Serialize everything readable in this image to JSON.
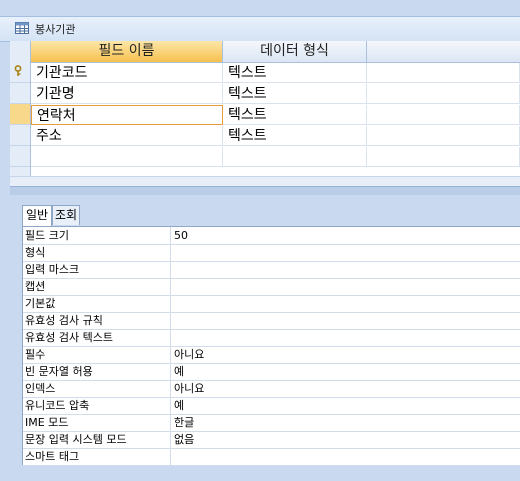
{
  "window": {
    "title": "봉사기관"
  },
  "grid": {
    "headers": [
      "필드 이름",
      "데이터 형식",
      ""
    ],
    "rows": [
      {
        "name": "기관코드",
        "type": "텍스트",
        "key": true
      },
      {
        "name": "기관명",
        "type": "텍스트",
        "key": false
      },
      {
        "name": "연락처",
        "type": "텍스트",
        "key": false,
        "current": true
      },
      {
        "name": "주소",
        "type": "텍스트",
        "key": false
      }
    ]
  },
  "property_tabs": [
    "일반",
    "조회"
  ],
  "properties": [
    {
      "name": "필드 크기",
      "value": "50"
    },
    {
      "name": "형식",
      "value": ""
    },
    {
      "name": "입력 마스크",
      "value": ""
    },
    {
      "name": "캡션",
      "value": ""
    },
    {
      "name": "기본값",
      "value": ""
    },
    {
      "name": "유효성 검사 규칙",
      "value": ""
    },
    {
      "name": "유효성 검사 텍스트",
      "value": ""
    },
    {
      "name": "필수",
      "value": "아니요"
    },
    {
      "name": "빈 문자열 허용",
      "value": "예"
    },
    {
      "name": "인덱스",
      "value": "아니요"
    },
    {
      "name": "유니코드 압축",
      "value": "예"
    },
    {
      "name": "IME 모드",
      "value": "한글"
    },
    {
      "name": "문장 입력 시스템 모드",
      "value": "없음"
    },
    {
      "name": "스마트 태그",
      "value": ""
    }
  ],
  "icons": {
    "window": "table-icon",
    "primary_key": "key-icon"
  },
  "colors": {
    "header_active": "#f7c04f",
    "current_row": "#f8d88a"
  }
}
